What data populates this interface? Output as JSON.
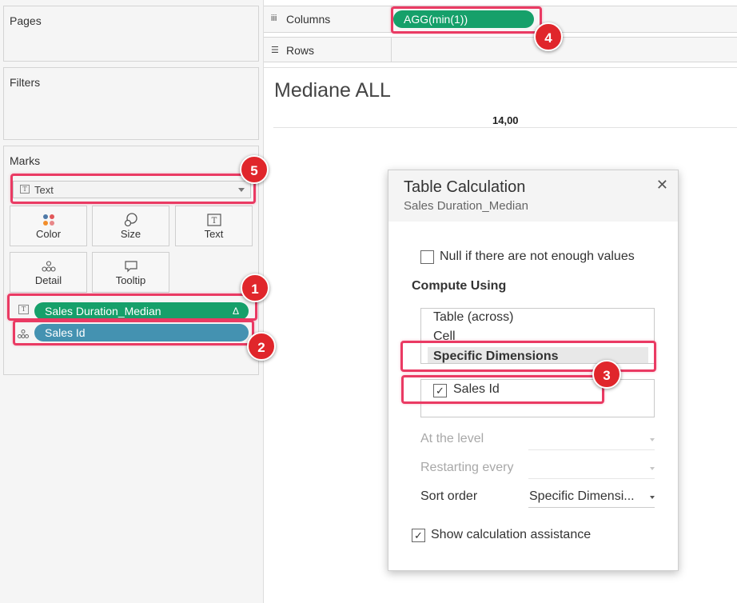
{
  "left_panel": {
    "pages_label": "Pages",
    "filters_label": "Filters",
    "marks_label": "Marks",
    "mark_type": "Text",
    "mark_buttons": [
      {
        "label": "Color",
        "icon": "color-dots-icon"
      },
      {
        "label": "Size",
        "icon": "size-shapes-icon"
      },
      {
        "label": "Text",
        "icon": "text-t-icon"
      },
      {
        "label": "Detail",
        "icon": "detail-dots-icon"
      },
      {
        "label": "Tooltip",
        "icon": "tooltip-bubble-icon"
      }
    ],
    "pills": [
      {
        "label": "Sales Duration_Median",
        "suffix": "Δ",
        "icon": "text-t-icon",
        "color": "#16a06a"
      },
      {
        "label": "Sales Id",
        "icon": "detail-dots-icon",
        "color": "#4492b1"
      }
    ]
  },
  "shelves": {
    "columns_label": "Columns",
    "columns_pill": "AGG(min(1))",
    "rows_label": "Rows"
  },
  "view": {
    "title": "Mediane ALL",
    "value": "14,00"
  },
  "dialog": {
    "title": "Table Calculation",
    "subtitle": "Sales Duration_Median",
    "null_checkbox_label": "Null if there are not enough values",
    "null_checked": false,
    "compute_using_label": "Compute Using",
    "compute_options": [
      "Table (across)",
      "Cell",
      "Specific Dimensions"
    ],
    "selected_option": "Specific Dimensions",
    "dimensions": [
      {
        "label": "Sales Id",
        "checked": true
      }
    ],
    "at_level_label": "At the level",
    "at_level_value": "",
    "restarting_label": "Restarting every",
    "restarting_value": "",
    "sort_order_label": "Sort order",
    "sort_order_value": "Specific Dimensi...",
    "show_assist_label": "Show calculation assistance",
    "show_assist_checked": true,
    "close_icon": "close-icon"
  },
  "annotations": {
    "badge_1": "1",
    "badge_2": "2",
    "badge_3": "3",
    "badge_4": "4",
    "badge_5": "5",
    "color": "#e0262b",
    "highlight_color": "#ea3a63"
  },
  "colors": {
    "green_pill": "#16a06a",
    "blue_pill": "#4492b1",
    "panel_bg": "#f5f5f5"
  }
}
